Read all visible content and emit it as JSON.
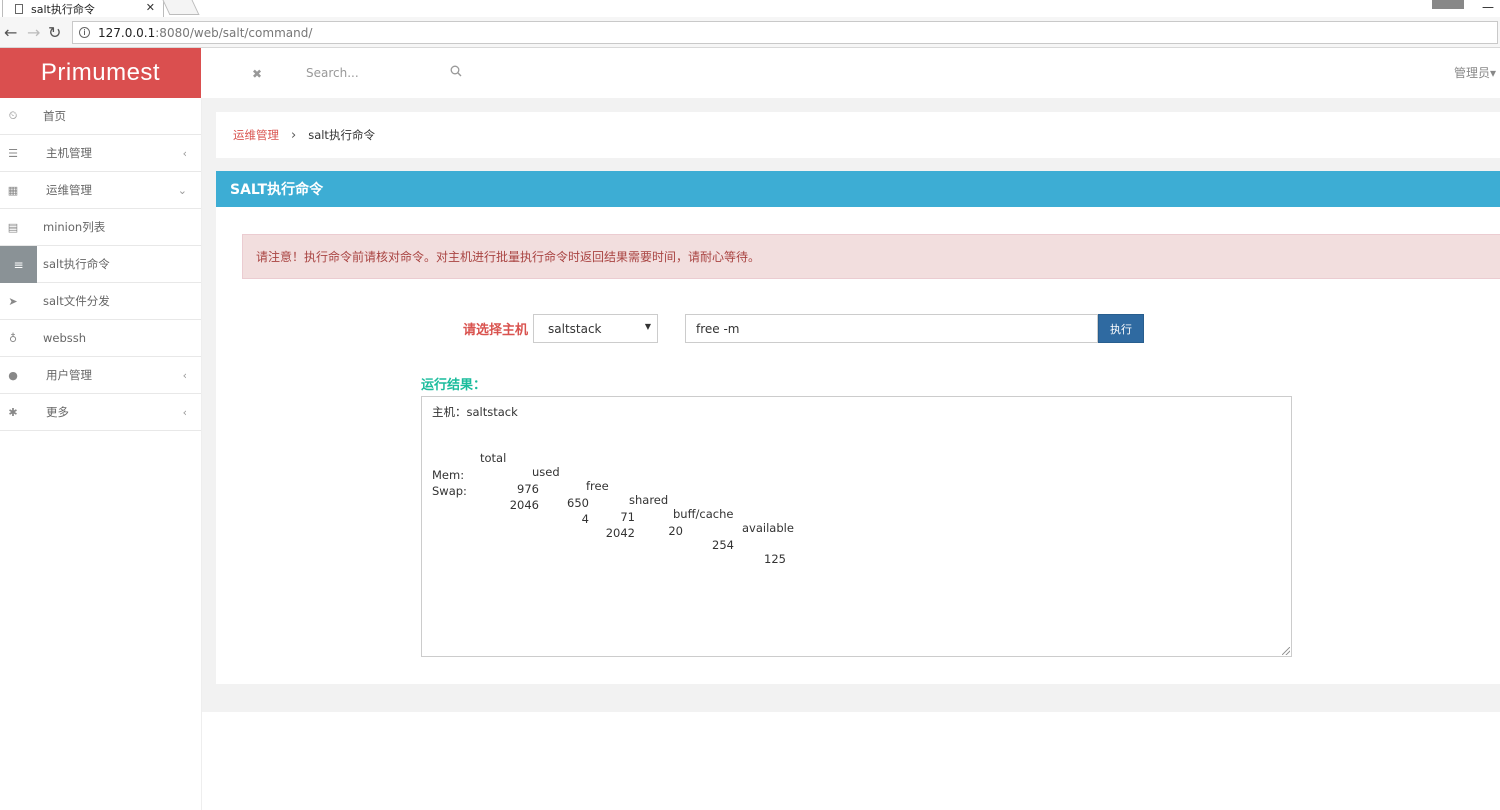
{
  "browser": {
    "tab_title": "salt执行命令",
    "tab_close": "✕",
    "url_host": "127.0.0.1",
    "url_rest": ":8080/web/salt/command/",
    "window_minimize": "—"
  },
  "brand": {
    "name": "Primumest",
    "color": "#da4f4f"
  },
  "topbar": {
    "search_placeholder": "Search...",
    "admin_label": "管理员▾"
  },
  "sidebar": {
    "items": [
      {
        "label": "首页",
        "icon": "dashboard-icon",
        "glyph": "⏲",
        "caret": ""
      },
      {
        "label": "主机管理",
        "icon": "server-icon",
        "glyph": "☰",
        "caret": "‹"
      },
      {
        "label": "运维管理",
        "icon": "grid-icon",
        "glyph": "▦",
        "caret": "⌄"
      },
      {
        "label": "minion列表",
        "icon": "list-icon",
        "glyph": "▤",
        "caret": ""
      },
      {
        "label": "salt执行命令",
        "icon": "bars-icon",
        "glyph": "≡",
        "caret": ""
      },
      {
        "label": "salt文件分发",
        "icon": "send-icon",
        "glyph": "➤",
        "caret": ""
      },
      {
        "label": "webssh",
        "icon": "linux-icon",
        "glyph": "♁",
        "caret": ""
      },
      {
        "label": "用户管理",
        "icon": "user-icon",
        "glyph": "●",
        "caret": "‹"
      },
      {
        "label": "更多",
        "icon": "gear-icon",
        "glyph": "✱",
        "caret": "‹"
      }
    ]
  },
  "breadcrumb": {
    "parent": "运维管理",
    "separator": "›",
    "current": "salt执行命令"
  },
  "panel": {
    "title": "SALT执行命令",
    "alert": "请注意！执行命令前请核对命令。对主机进行批量执行命令时返回结果需要时间，请耐心等待。",
    "host_label": "请选择主机",
    "host_selected": "saltstack",
    "command_value": "free -m",
    "exec_label": "执行",
    "result_label": "运行结果：",
    "result": {
      "host_line": "主机：saltstack",
      "headers": [
        "total",
        "used",
        "free",
        "shared",
        "buff/cache",
        "available"
      ],
      "rows": [
        {
          "name": "Mem:",
          "values": [
            "976",
            "650",
            "71",
            "20",
            "254",
            "125"
          ]
        },
        {
          "name": "Swap:",
          "values": [
            "2046",
            "4",
            "2042",
            "",
            "",
            ""
          ]
        }
      ]
    }
  },
  "colors": {
    "panel_heading": "#3dadd4",
    "exec_button": "#2f6aa1",
    "result_label": "#1abc9c",
    "alert_bg": "#f2dede"
  }
}
